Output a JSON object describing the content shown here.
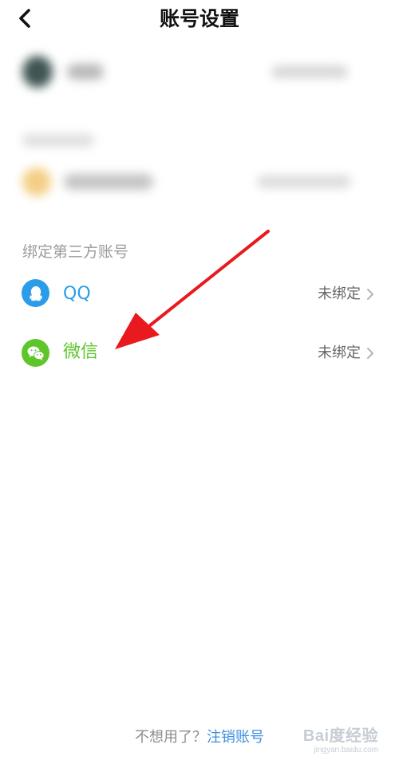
{
  "header": {
    "title": "账号设置"
  },
  "bind_section": {
    "label": "绑定第三方账号",
    "items": [
      {
        "name": "QQ",
        "status": "未绑定",
        "color": "#2b9de8",
        "icon": "qq-icon"
      },
      {
        "name": "微信",
        "status": "未绑定",
        "color": "#5ec62a",
        "icon": "wechat-icon"
      }
    ]
  },
  "footer": {
    "question": "不想用了？",
    "cancel_link": "注销账号"
  },
  "watermark": {
    "main": "Bai度经验",
    "sub": "jingyan.baidu.com"
  },
  "colors": {
    "arrow": "#e8191f",
    "link": "#3b8fe0"
  }
}
